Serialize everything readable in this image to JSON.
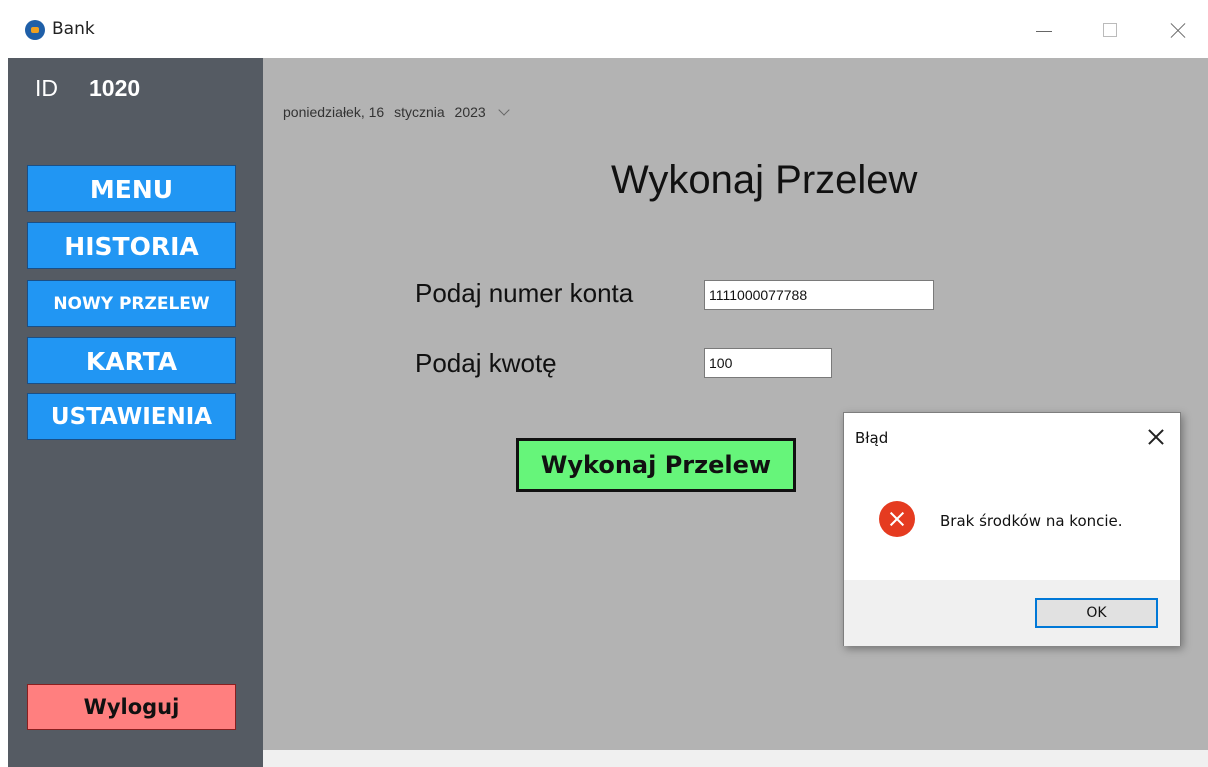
{
  "window": {
    "title": "Bank",
    "icon": "bank-app-icon"
  },
  "sidebar": {
    "id_label": "ID",
    "id_value": "1020",
    "nav": {
      "menu": "MENU",
      "historia": "HISTORIA",
      "nowy_przelew": "NOWY PRZELEW",
      "karta": "KARTA",
      "ustawienia": "USTAWIENIA"
    },
    "logout": "Wyloguj",
    "colors": {
      "nav": "#2196f3",
      "logout": "#ff7f7f",
      "background": "#555b63"
    }
  },
  "main": {
    "date": {
      "weekday_day": "poniedziałek, 16",
      "month": "stycznia",
      "year": "2023"
    },
    "title": "Wykonaj Przelew",
    "account_label": "Podaj numer konta",
    "account_value": "1111000077788",
    "amount_label": "Podaj kwotę",
    "amount_value": "100",
    "submit": "Wykonaj Przelew",
    "colors": {
      "submit": "#66f57a",
      "background": "#b3b3b3"
    }
  },
  "dialog": {
    "title": "Błąd",
    "message": "Brak środków na koncie.",
    "ok": "OK",
    "icon": "error-icon"
  }
}
